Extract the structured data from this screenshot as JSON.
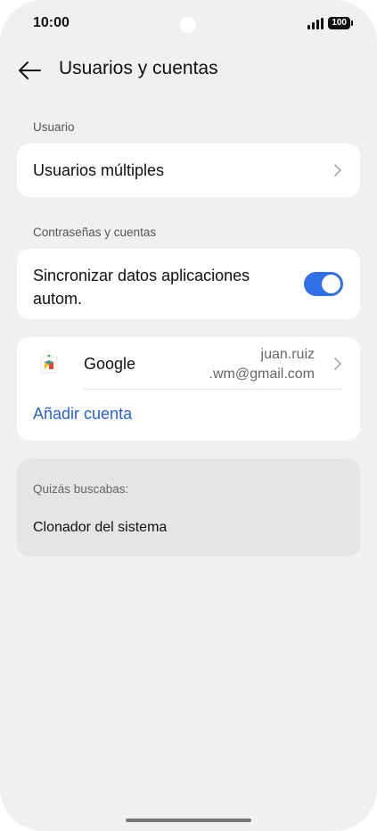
{
  "status_bar": {
    "time": "10:00",
    "battery": "100"
  },
  "header": {
    "title": "Usuarios y cuentas",
    "back_icon": "arrow-left-icon"
  },
  "sections": {
    "user_label": "Usuario",
    "accounts_label": "Contraseñas y cuentas"
  },
  "users": {
    "multiple_users_label": "Usuarios múltiples"
  },
  "sync": {
    "label_line1": "Sincronizar datos aplicaciones",
    "label_line2": "autom.",
    "enabled": true,
    "accent_color": "#2f6fe8"
  },
  "accounts": {
    "google_name": "Google",
    "google_email_line1": "juan.ruiz",
    "google_email_line2": ".wm@gmail.com",
    "add_account_label": "Añadir cuenta",
    "link_color": "#2a63c9"
  },
  "suggestions": {
    "label": "Quizás buscabas:",
    "item": "Clonador del sistema"
  }
}
